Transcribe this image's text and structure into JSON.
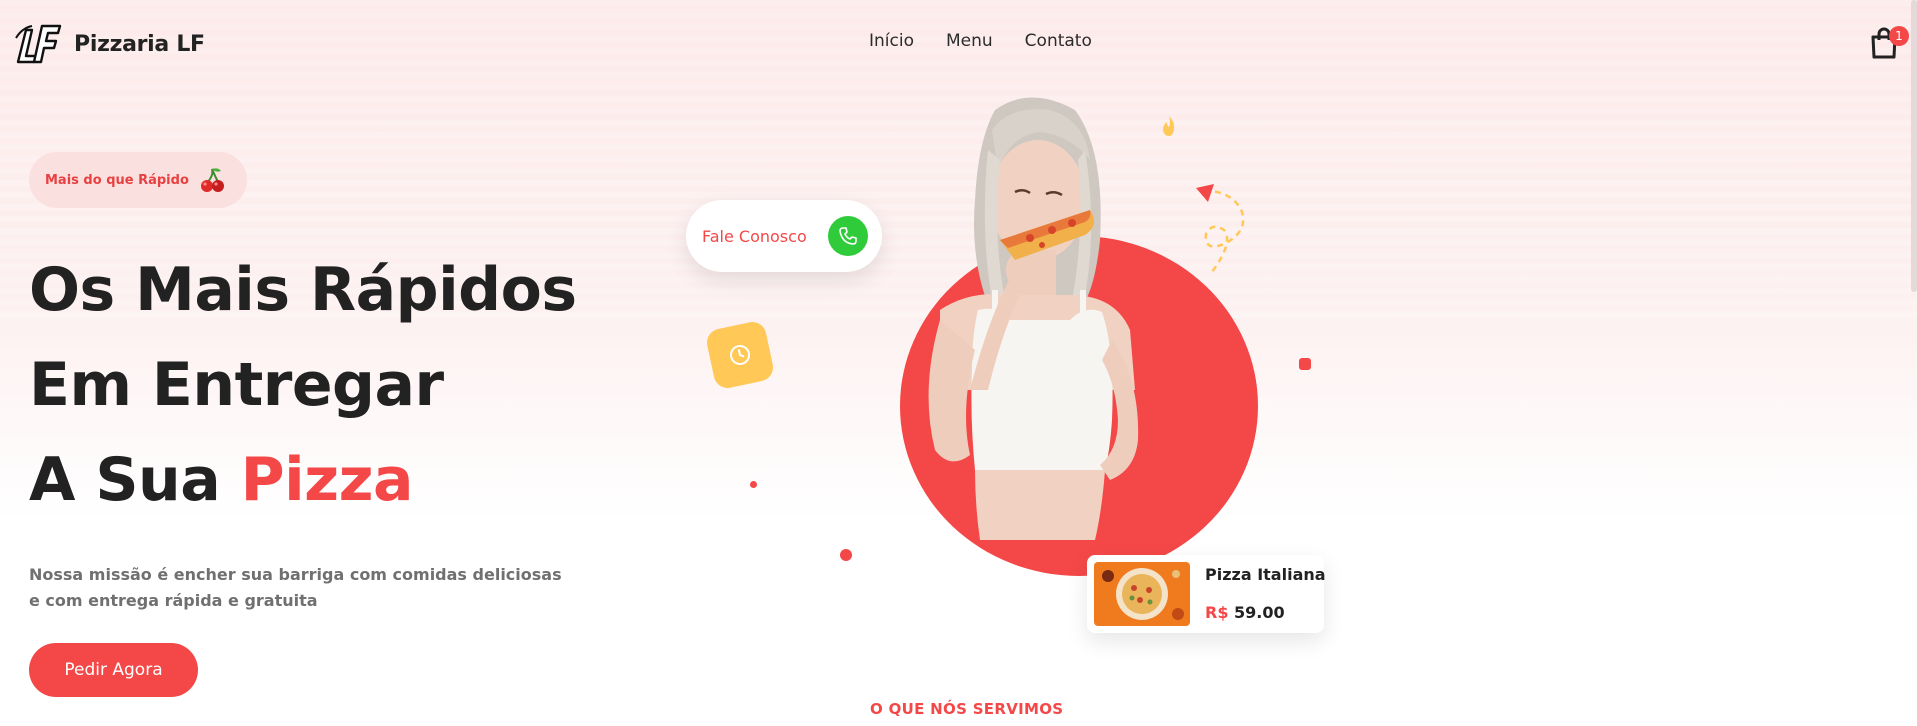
{
  "header": {
    "brand": "Pizzaria LF",
    "nav": [
      "Início",
      "Menu",
      "Contato"
    ],
    "cart_count": "1"
  },
  "hero": {
    "badge": "Mais do que Rápido",
    "headline_line1": "Os Mais Rápidos",
    "headline_line2": "Em Entregar",
    "headline_line3_prefix": "A Sua",
    "headline_line3_accent": "Pizza",
    "description": "Nossa missão é encher sua barriga com comidas deliciosas e com entrega rápida e gratuita",
    "cta": "Pedir Agora",
    "contact_label": "Fale Conosco"
  },
  "product": {
    "name": "Pizza Italiana",
    "currency": "R$",
    "price": "59.00"
  },
  "section_label": "O QUE NÓS SERVIMOS",
  "colors": {
    "accent": "#f44848",
    "yellow": "#ffc857",
    "green": "#2fcb3a",
    "text": "#222222"
  }
}
